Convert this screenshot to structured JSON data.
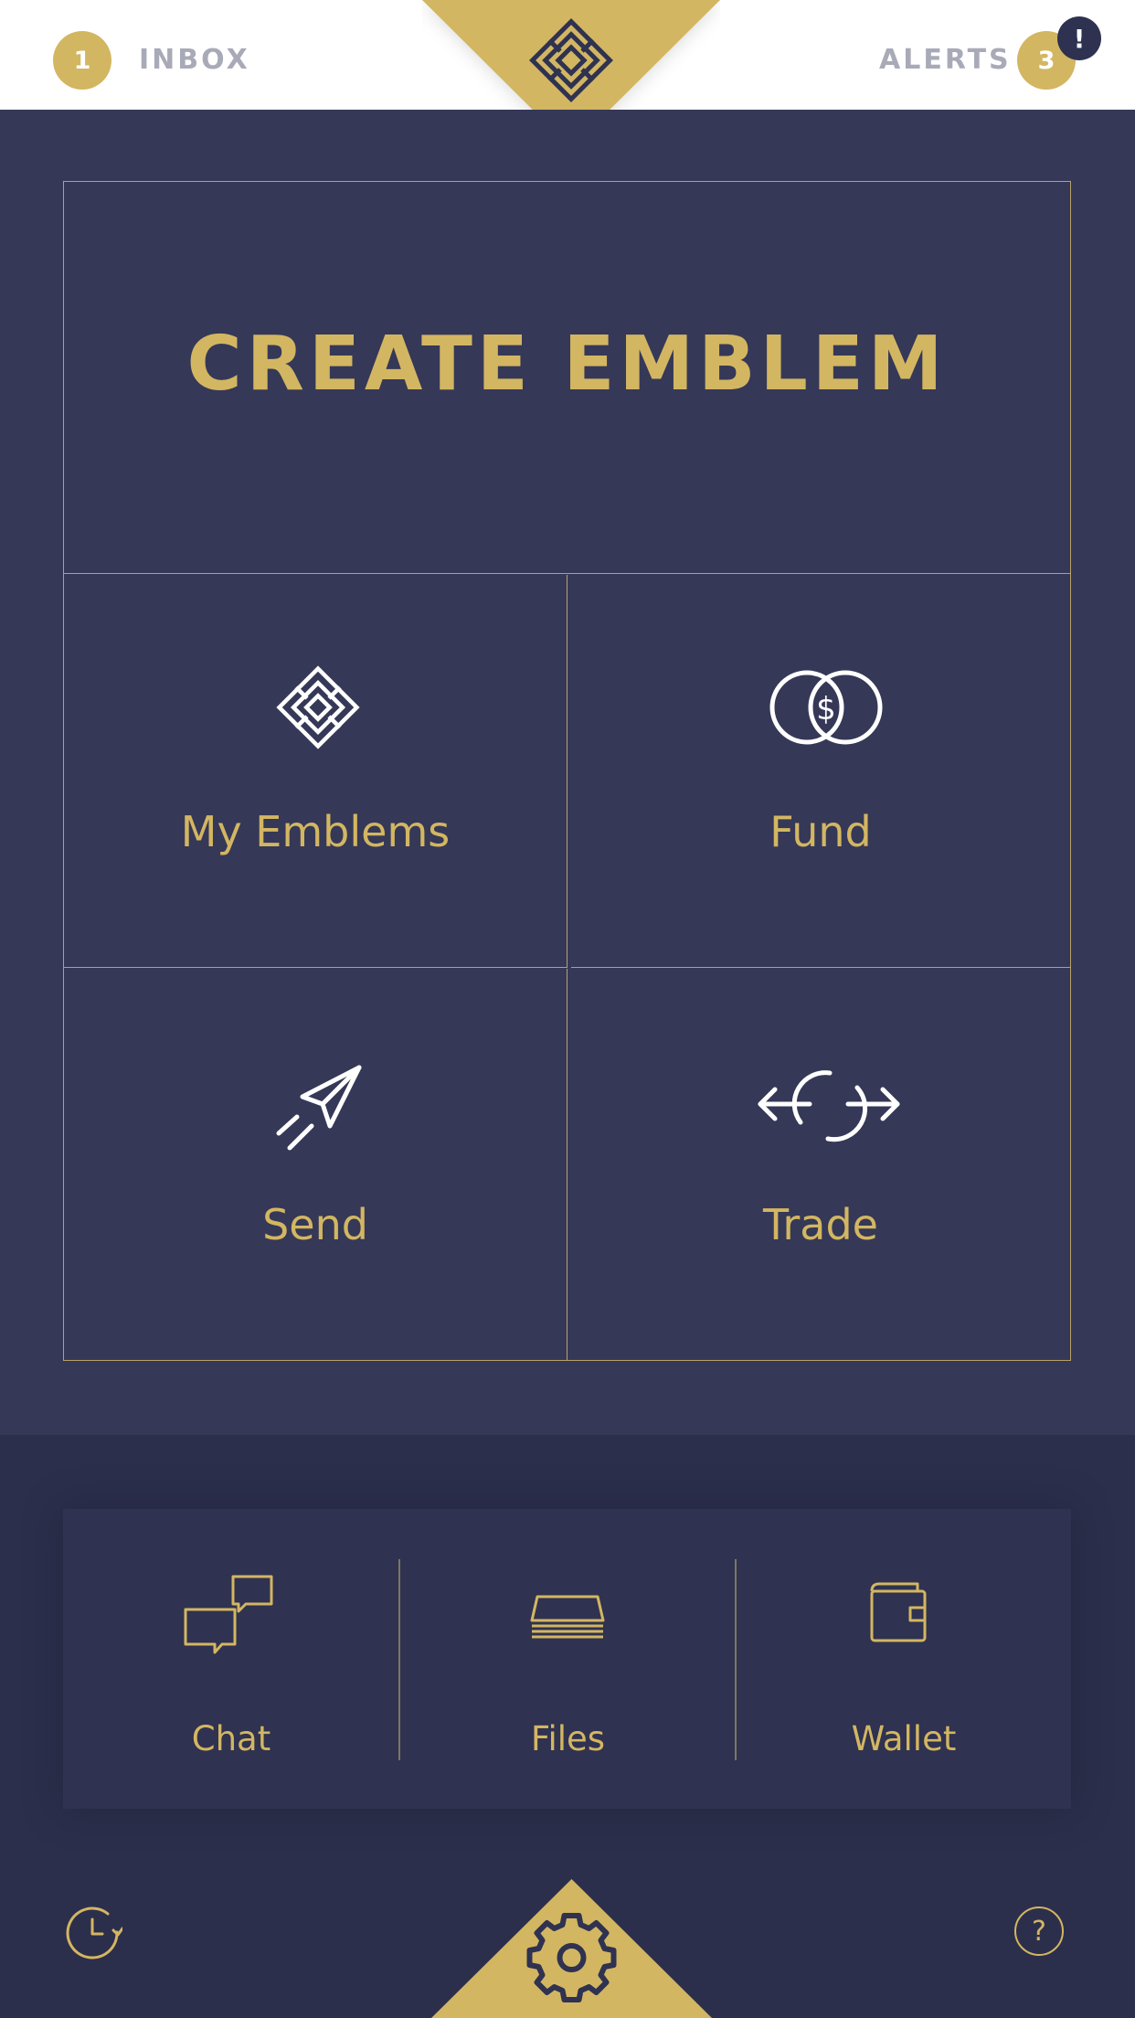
{
  "header": {
    "inbox": {
      "count": "1",
      "label": "INBOX"
    },
    "alerts": {
      "count": "3",
      "label": "ALERTS",
      "indicator": "!"
    },
    "logo_icon": "emblem-logo-icon"
  },
  "main": {
    "create_label": "CREATE EMBLEM",
    "tiles": [
      {
        "label": "My Emblems",
        "icon": "emblem-icon"
      },
      {
        "label": "Fund",
        "icon": "coins-dollar-icon"
      },
      {
        "label": "Send",
        "icon": "paper-plane-icon"
      },
      {
        "label": "Trade",
        "icon": "trade-arrows-icon"
      }
    ]
  },
  "dock": {
    "items": [
      {
        "label": "Chat",
        "icon": "chat-bubbles-icon"
      },
      {
        "label": "Files",
        "icon": "files-stack-icon"
      },
      {
        "label": "Wallet",
        "icon": "wallet-icon"
      }
    ]
  },
  "footer": {
    "history_icon": "history-icon",
    "settings_icon": "gear-icon",
    "help": "?"
  },
  "colors": {
    "gold": "#d3b662",
    "navy": "#353857",
    "navy_dark": "#2c2f4c",
    "header_bg": "#ffffff",
    "muted_label": "#a8aab8"
  }
}
